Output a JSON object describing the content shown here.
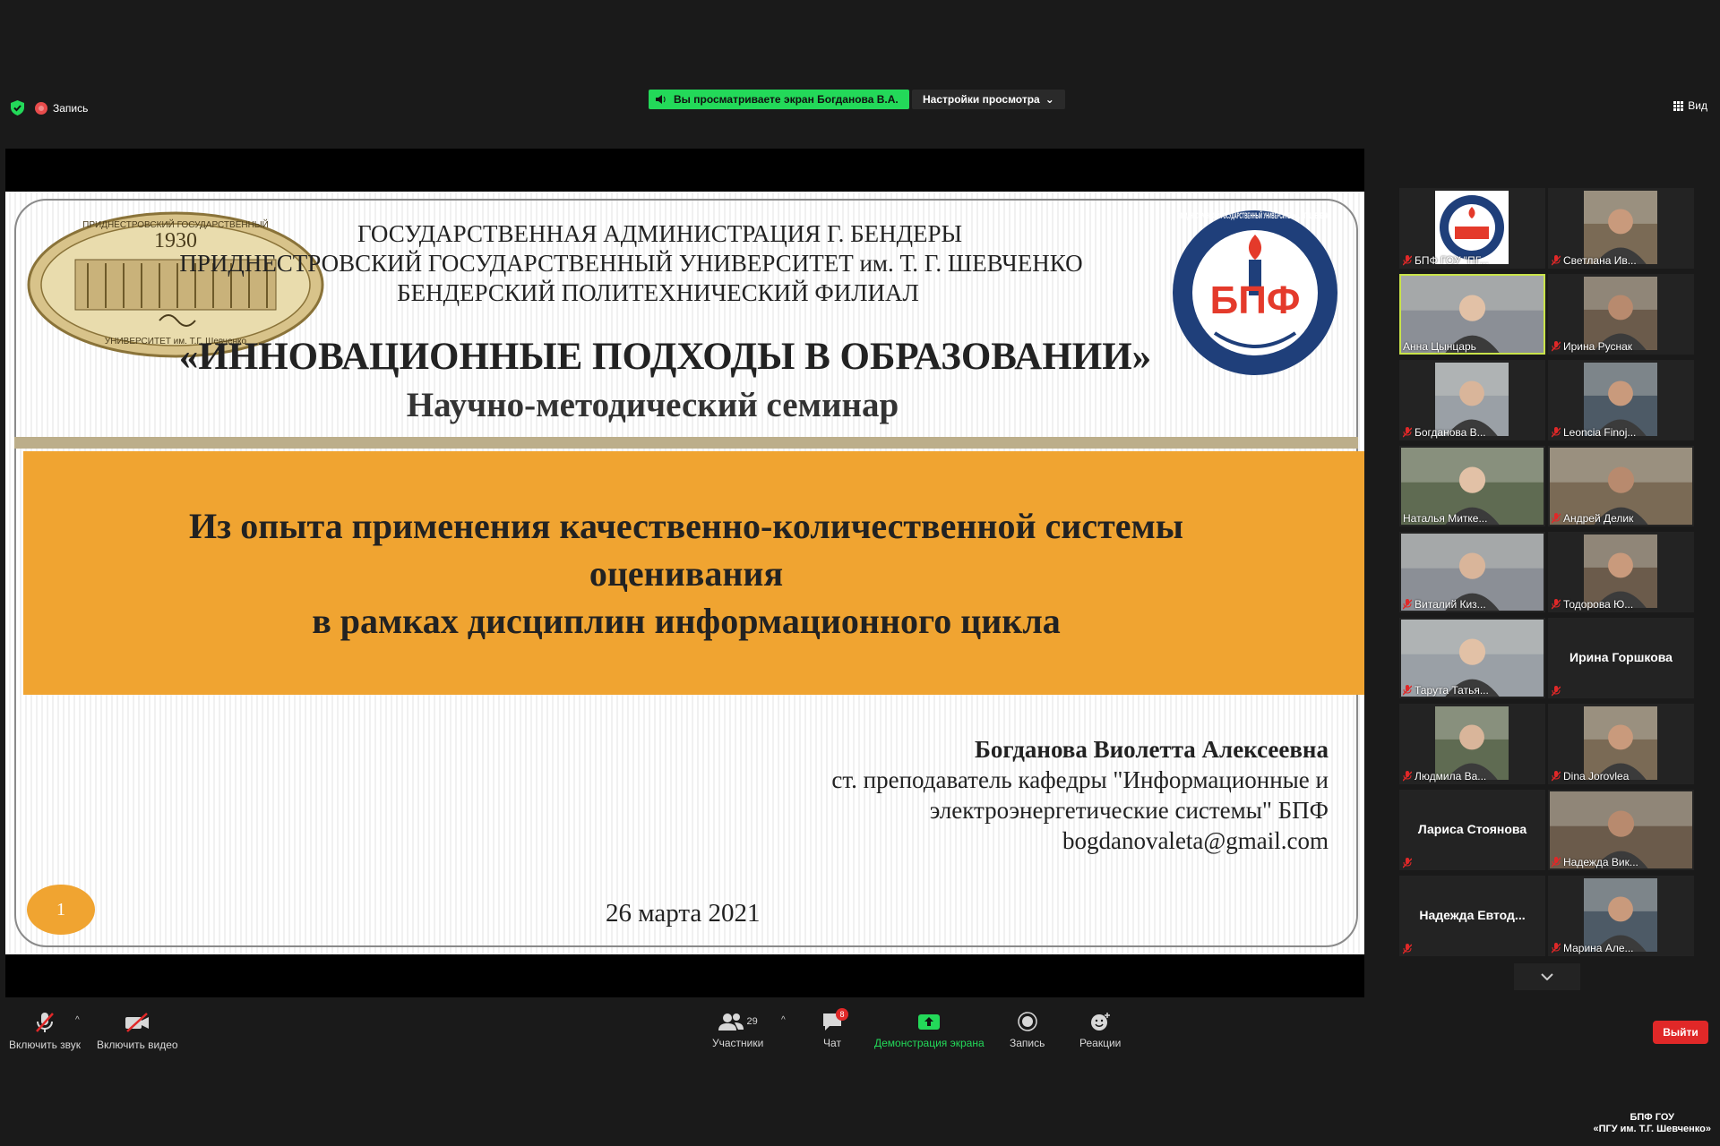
{
  "top_bar": {
    "record_label": "Запись",
    "share_banner": "Вы просматриваете экран Богданова В.А.",
    "view_options": "Настройки просмотра",
    "view_label": "Вид"
  },
  "slide": {
    "header_lines": [
      "ГОСУДАРСТВЕННАЯ АДМИНИСТРАЦИЯ Г. БЕНДЕРЫ",
      "ПРИДНЕСТРОВСКИЙ ГОСУДАРСТВЕННЫЙ УНИВЕРСИТЕТ им. Т. Г. ШЕВЧЕНКО",
      "БЕНДЕРСКИЙ ПОЛИТЕХНИЧЕСКИЙ ФИЛИАЛ"
    ],
    "title": "«ИННОВАЦИОННЫЕ ПОДХОДЫ В ОБРАЗОВАНИИ»",
    "subtitle": "Научно-методический семинар",
    "topic_lines": [
      "Из опыта применения качественно-количественной системы",
      "оценивания",
      "в рамках дисциплин информационного цикла"
    ],
    "author_name": "Богданова Виолетта Алексеевна",
    "author_lines": [
      "ст. преподаватель кафедры \"Информационные и",
      "электроэнергетические системы\" БПФ",
      "bogdanovaleta@gmail.com"
    ],
    "date": "26 марта 2021",
    "page_number": "1",
    "seal_year": "1930",
    "seal_text_top": "ПРИДНЕСТРОВСКИЙ ГОСУДАРСТВЕННЫЙ",
    "seal_text_bottom": "УНИВЕРСИТЕТ им. Т.Г. Шевченко",
    "logo_text": "БПФ",
    "logo_ring_text": "ПРИДНЕСТРОВСКИЙ ГОСУДАРСТВЕННЫЙ УНИВЕРСИТЕТ им. Т.Г. ШЕВЧЕНКО",
    "colors": {
      "orange": "#f0a431",
      "separator": "#bcae8a"
    }
  },
  "participants": [
    {
      "name": "БПФ ГОУ \"ПГ...",
      "video": "logo",
      "muted": true
    },
    {
      "name": "Светлана Ив...",
      "video": "portrait",
      "muted": true
    },
    {
      "name": "Анна Цынцарь",
      "video": "wide",
      "muted": false,
      "active": true
    },
    {
      "name": "Ирина Руснак",
      "video": "portrait",
      "muted": true
    },
    {
      "name": "Богданова В...",
      "video": "portrait",
      "muted": true
    },
    {
      "name": "Leoncia Finoj...",
      "video": "portrait",
      "muted": true
    },
    {
      "name": "Наталья Митке...",
      "video": "wide",
      "muted": false
    },
    {
      "name": "Андрей Делик",
      "video": "wide",
      "muted": true
    },
    {
      "name": "Виталий Киз...",
      "video": "wide",
      "muted": true
    },
    {
      "name": "Тодорова Ю...",
      "video": "portrait",
      "muted": true
    },
    {
      "name": "Тарута Татья...",
      "video": "wide",
      "muted": true
    },
    {
      "name": "Ирина Горшкова",
      "video": "none",
      "muted": true
    },
    {
      "name": "Людмила Ва...",
      "video": "portrait",
      "muted": true
    },
    {
      "name": "Dina Jorovlea",
      "video": "portrait",
      "muted": true
    },
    {
      "name": "Лариса Стоянова",
      "video": "none",
      "muted": true
    },
    {
      "name": "Надежда Вик...",
      "video": "wide",
      "muted": true
    },
    {
      "name": "Надежда  Евтод...",
      "video": "none",
      "muted": true
    },
    {
      "name": "Марина Але...",
      "video": "portrait",
      "muted": true
    }
  ],
  "toolbar": {
    "mute_label": "Включить звук",
    "video_label": "Включить видео",
    "participants_label": "Участники",
    "participants_count": "29",
    "chat_label": "Чат",
    "chat_badge": "8",
    "share_label": "Демонстрация экрана",
    "record_label": "Запись",
    "reactions_label": "Реакции",
    "leave_label": "Выйти"
  },
  "watermark": {
    "line1": "БПФ ГОУ",
    "line2": "«ПГУ им. Т.Г. Шевченко»"
  }
}
